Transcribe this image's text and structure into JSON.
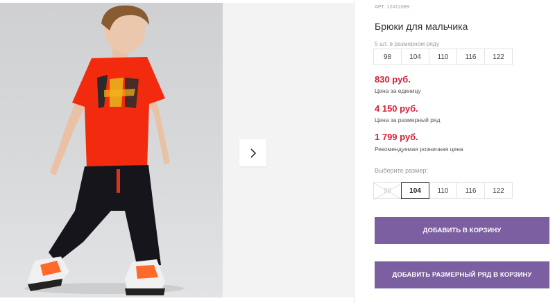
{
  "product": {
    "article": "АРТ. 12412089",
    "title": "Брюки для мальчика"
  },
  "series_sizes": {
    "caption": "5 шт. в размерном ряду",
    "sizes": [
      "98",
      "104",
      "110",
      "116",
      "122"
    ]
  },
  "prices": [
    {
      "amount": "830 руб.",
      "label": "Цена за единицу"
    },
    {
      "amount": "4 150 руб.",
      "label": "Цена за размерный ряд"
    },
    {
      "amount": "1 799 руб.",
      "label": "Рекомендуемая розничная цена"
    }
  ],
  "size_picker": {
    "label": "Выберите размер:",
    "sizes": [
      "98",
      "104",
      "110",
      "116",
      "122"
    ],
    "selected": "104",
    "unavailable": [
      "98"
    ]
  },
  "buttons": {
    "add_to_cart": "ДОБАВИТЬ В КОРЗИНУ",
    "add_series_to_cart": "ДОБАВИТЬ РАЗМЕРНЫЙ РЯД В КОРЗИНУ"
  },
  "icons": {
    "next": "chevron-right-icon"
  },
  "colors": {
    "price": "#d4213a",
    "button": "#7c5fa0",
    "shirt": "#f22a0e",
    "pants": "#15151b"
  }
}
